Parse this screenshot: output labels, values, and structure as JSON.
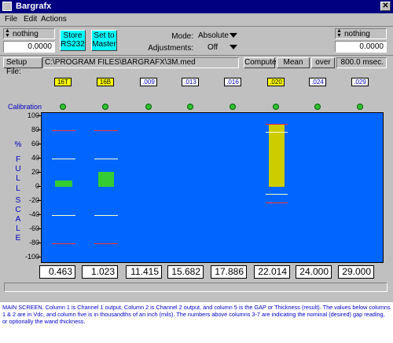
{
  "window": {
    "title": "Bargrafx",
    "close_glyph": "✕"
  },
  "menu": {
    "items": [
      "File",
      "Edit",
      "Actions"
    ]
  },
  "left_channel": {
    "selection": "nothing",
    "value": "0.0000"
  },
  "right_channel": {
    "selection": "nothing",
    "value": "0.0000"
  },
  "buttons": {
    "store": "Store RS232",
    "set_master": "Set to Master"
  },
  "mode": {
    "label": "Mode:",
    "value": "Absolute"
  },
  "adjustments": {
    "label": "Adjustments:",
    "value": "Off"
  },
  "setup": {
    "label": "Setup File:",
    "path": "C:\\PROGRAM FILES\\BARGRAFX\\3M.med"
  },
  "compute": {
    "label": "Compute",
    "mode": "Mean",
    "over": "over",
    "time": "800.0 msec."
  },
  "column_tags": [
    {
      "label": "16T",
      "style": "yellow"
    },
    {
      "label": "16B",
      "style": "yellow"
    },
    {
      "label": ".009",
      "style": "white"
    },
    {
      "label": ".013",
      "style": "white"
    },
    {
      "label": ".016",
      "style": "white"
    },
    {
      "label": ".020",
      "style": "yellow"
    },
    {
      "label": ".024",
      "style": "white"
    },
    {
      "label": ".029",
      "style": "white"
    }
  ],
  "calibration_label": "Calibration",
  "axis": {
    "ticks": [
      "100",
      "80",
      "60",
      "40",
      "20",
      "0",
      "-20",
      "-40",
      "-60",
      "-80",
      "-100"
    ],
    "vertical_label": [
      "%",
      "F",
      "U",
      "L",
      "L",
      "S",
      "C",
      "A",
      "L",
      "E"
    ]
  },
  "chart_data": {
    "type": "bar",
    "ylim": [
      -100,
      100
    ],
    "bars": [
      {
        "column": 1,
        "low": 0,
        "high": 9,
        "color": "#33cc33",
        "upper_limit": 40,
        "lower_limit": -40,
        "red_upper": 80,
        "red_lower": -80
      },
      {
        "column": 2,
        "low": 0,
        "high": 21,
        "color": "#33cc33",
        "upper_limit": 40,
        "lower_limit": -40,
        "red_upper": 80,
        "red_lower": -80
      },
      {
        "column": 6,
        "low": 0,
        "high": 89,
        "color": "#cccc00",
        "upper_limit": 78,
        "lower_limit": -10,
        "red_upper": 89,
        "red_lower": -22
      }
    ]
  },
  "values": [
    "0.463",
    "1.023",
    "11.415",
    "15.682",
    "17.886",
    "22.014",
    "24.000",
    "29.000"
  ],
  "caption": "MAIN SCREEN. Column 1 is Channel 1 output, Column 2 is Channel 2 output, and column 5 is the GAP or Thickness (result).  The values below columns 1 & 2 are in Vdc, and column five is in thousandths of an inch (mils). The numbers above columns 3-7 are indicating the nominal (desired) gap reading, or optionally the wand thickness."
}
